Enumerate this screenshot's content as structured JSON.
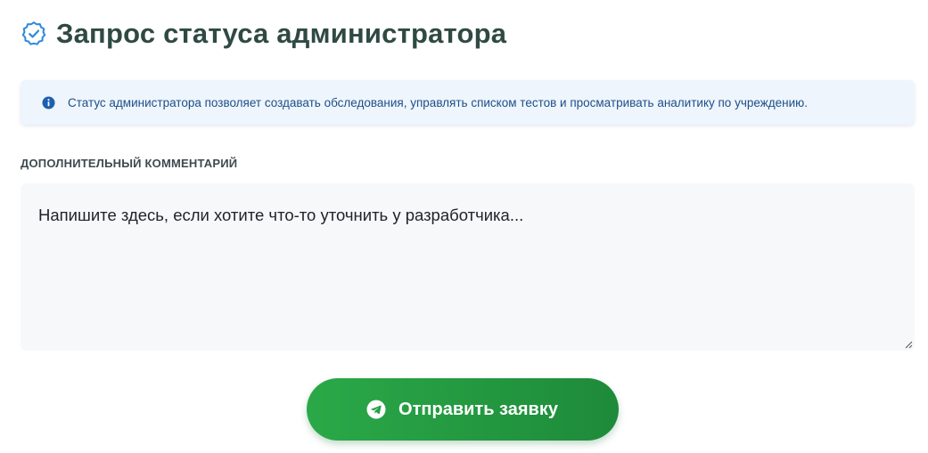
{
  "header": {
    "title": "Запрос статуса администратора",
    "icon": "verified-badge-icon",
    "icon_color": "#2e88d9"
  },
  "info": {
    "icon": "info-icon",
    "text": "Статус администратора позволяет создавать обследования, управлять списком тестов и просматривать аналитику по учреждению.",
    "background": "#eef5fd",
    "text_color": "#1e4f87"
  },
  "comment": {
    "label": "ДОПОЛНИТЕЛЬНЫЙ КОММЕНТАРИЙ",
    "value": "",
    "placeholder": "Напишите здесь, если хотите что-то уточнить у разработчика..."
  },
  "submit": {
    "icon": "telegram-send-icon",
    "label": "Отправить заявку",
    "color_start": "#2aa948",
    "color_end": "#1e8a3a"
  }
}
